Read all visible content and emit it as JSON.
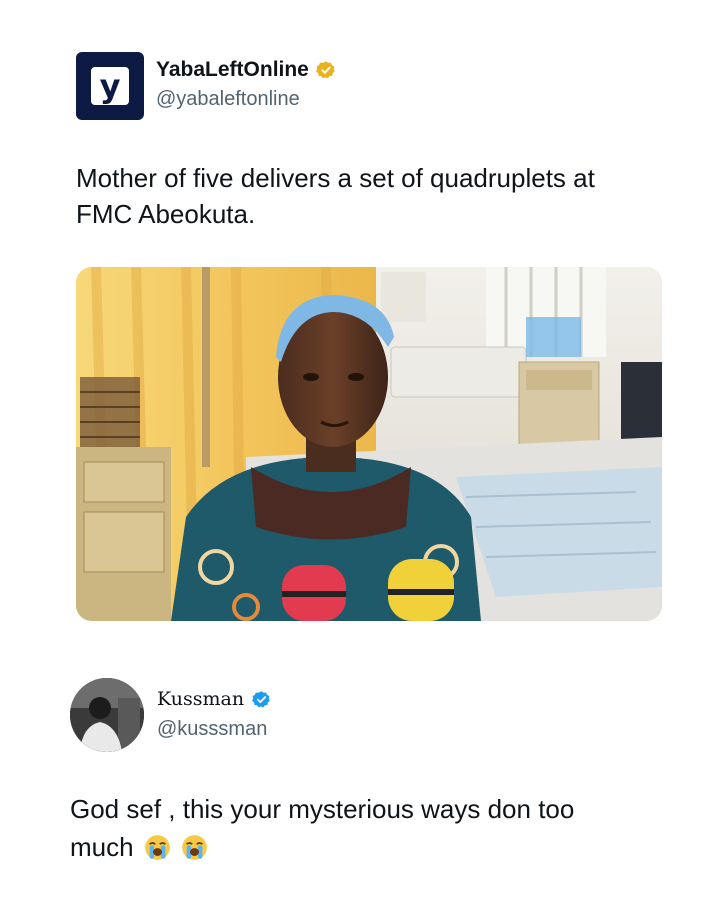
{
  "tweet1": {
    "avatar_icon": "yabaleft-logo",
    "avatar_letter": "y",
    "name": "YabaLeftOnline",
    "handle": "@yabaleftonline",
    "verified_badge": "gold-checkmark-icon",
    "text_line1": "Mother of five delivers a set of quadruplets at",
    "text_line2": "FMC Abeokuta.",
    "colors": {
      "brand": "#0d1a44",
      "badge": "#e8b21e"
    }
  },
  "tweet2": {
    "name": "Kussman",
    "handle": "@kusssman",
    "verified_badge": "blue-checkmark-icon",
    "text_line1": "God sef , this your mysterious ways don too",
    "text_line2": "much",
    "emojis": [
      "loudly-crying-face-emoji",
      "loudly-crying-face-emoji"
    ],
    "colors": {
      "badge": "#1d9bf0"
    }
  }
}
